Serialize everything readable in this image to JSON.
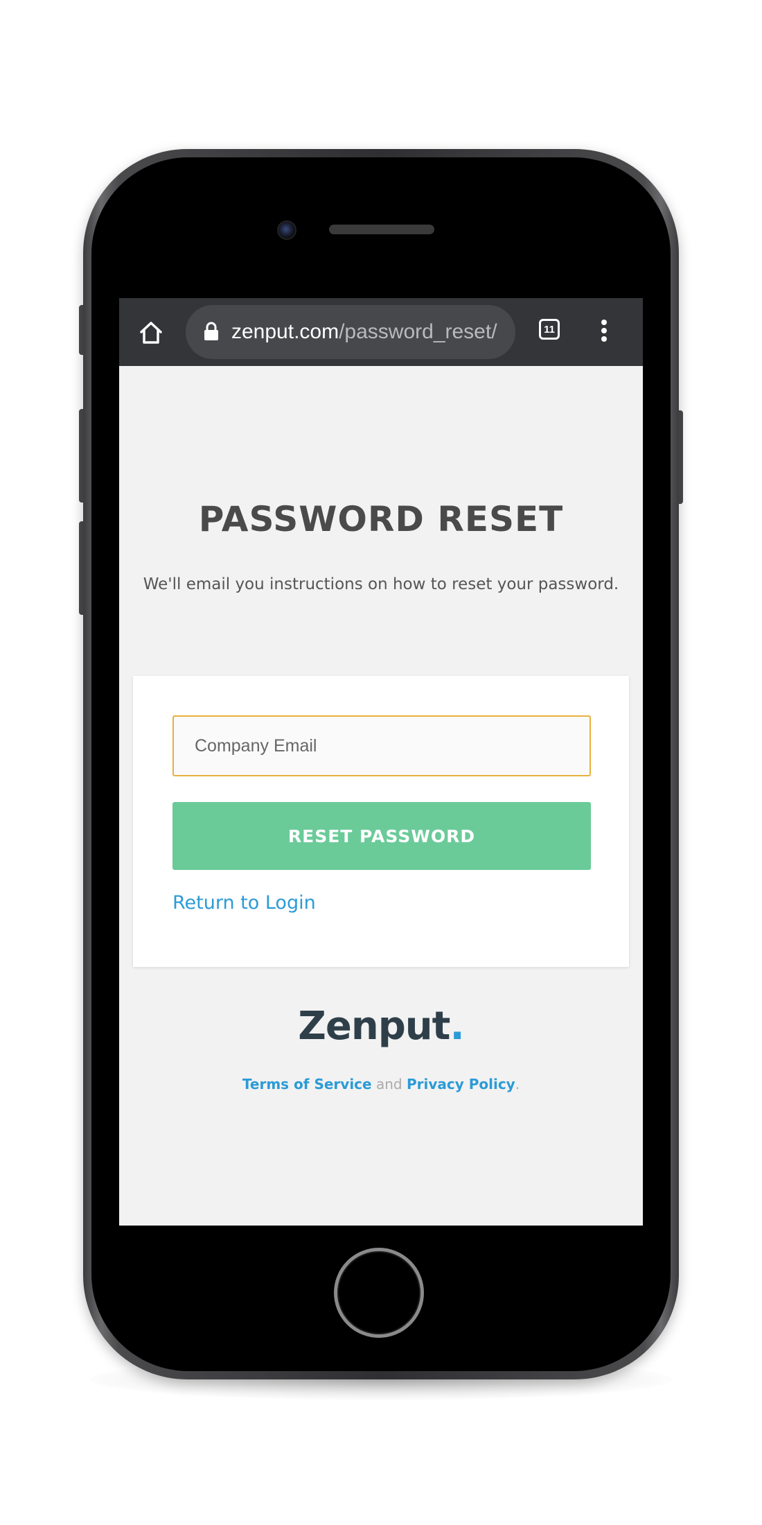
{
  "browser": {
    "url_domain": "zenput.com",
    "url_path": "/password_reset/",
    "tab_count": "11",
    "icons": {
      "home": "home-icon",
      "lock": "lock-icon",
      "tabs": "tabs-icon",
      "menu": "more-vert-icon"
    }
  },
  "page": {
    "title": "PASSWORD RESET",
    "subtitle": "We'll email you instructions on how to reset your password."
  },
  "form": {
    "email_value": "",
    "email_placeholder": "Company Email",
    "reset_button_label": "RESET PASSWORD",
    "return_link_label": "Return to Login"
  },
  "brand": {
    "logo_text": "Zenput",
    "logo_dot": "."
  },
  "footer": {
    "terms_label": "Terms of Service",
    "and_text": " and ",
    "privacy_label": "Privacy Policy",
    "period": "."
  },
  "colors": {
    "accent_green": "#6acb99",
    "link_blue": "#2b9bd6",
    "input_focus_border": "#e8b03f",
    "browser_bar": "#333538",
    "page_background": "#f2f2f2"
  }
}
